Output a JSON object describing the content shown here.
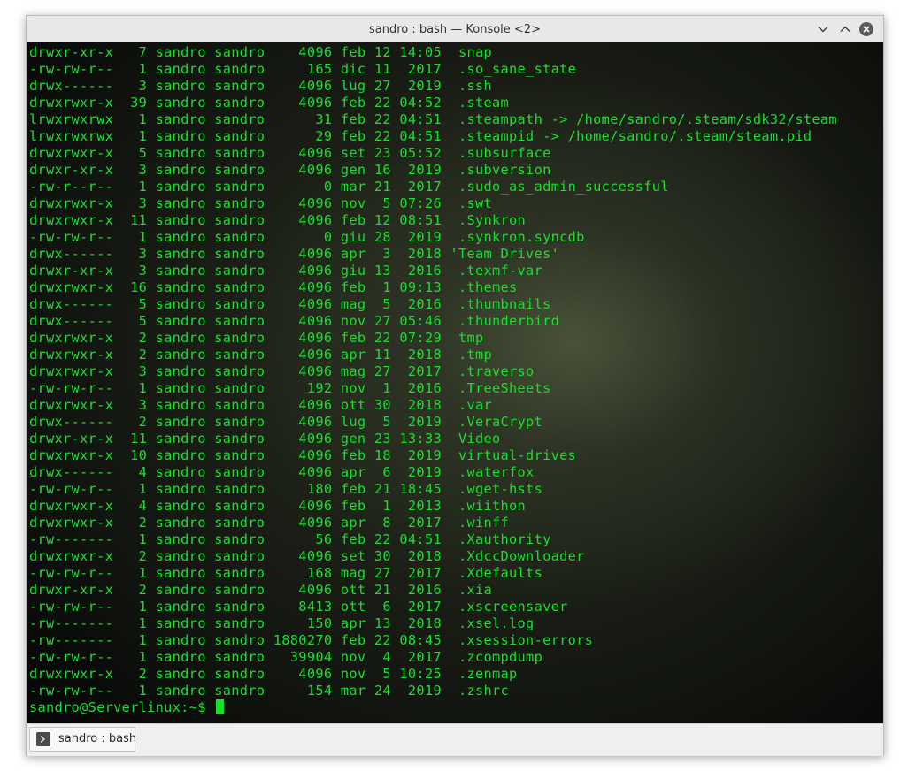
{
  "window": {
    "title": "sandro : bash — Konsole <2>"
  },
  "terminal": {
    "lines": [
      "drwxr-xr-x   7 sandro sandro    4096 feb 12 14:05  snap",
      "-rw-rw-r--   1 sandro sandro     165 dic 11  2017  .so_sane_state",
      "drwx------   3 sandro sandro    4096 lug 27  2019  .ssh",
      "drwxrwxr-x  39 sandro sandro    4096 feb 22 04:52  .steam",
      "lrwxrwxrwx   1 sandro sandro      31 feb 22 04:51  .steampath -> /home/sandro/.steam/sdk32/steam",
      "lrwxrwxrwx   1 sandro sandro      29 feb 22 04:51  .steampid -> /home/sandro/.steam/steam.pid",
      "drwxrwxr-x   5 sandro sandro    4096 set 23 05:52  .subsurface",
      "drwxr-xr-x   3 sandro sandro    4096 gen 16  2019  .subversion",
      "-rw-r--r--   1 sandro sandro       0 mar 21  2017  .sudo_as_admin_successful",
      "drwxrwxr-x   3 sandro sandro    4096 nov  5 07:26  .swt",
      "drwxrwxr-x  11 sandro sandro    4096 feb 12 08:51  .Synkron",
      "-rw-rw-r--   1 sandro sandro       0 giu 28  2019  .synkron.syncdb",
      "drwx------   3 sandro sandro    4096 apr  3  2018 'Team Drives'",
      "drwxr-xr-x   3 sandro sandro    4096 giu 13  2016  .texmf-var",
      "drwxrwxr-x  16 sandro sandro    4096 feb  1 09:13  .themes",
      "drwx------   5 sandro sandro    4096 mag  5  2016  .thumbnails",
      "drwx------   5 sandro sandro    4096 nov 27 05:46  .thunderbird",
      "drwxrwxr-x   2 sandro sandro    4096 feb 22 07:29  tmp",
      "drwxrwxr-x   2 sandro sandro    4096 apr 11  2018  .tmp",
      "drwxrwxr-x   3 sandro sandro    4096 mag 27  2017  .traverso",
      "-rw-rw-r--   1 sandro sandro     192 nov  1  2016  .TreeSheets",
      "drwxrwxr-x   3 sandro sandro    4096 ott 30  2018  .var",
      "drwx------   2 sandro sandro    4096 lug  5  2019  .VeraCrypt",
      "drwxr-xr-x  11 sandro sandro    4096 gen 23 13:33  Video",
      "drwxrwxr-x  10 sandro sandro    4096 feb 18  2019  virtual-drives",
      "drwx------   4 sandro sandro    4096 apr  6  2019  .waterfox",
      "-rw-rw-r--   1 sandro sandro     180 feb 21 18:45  .wget-hsts",
      "drwxrwxr-x   4 sandro sandro    4096 feb  1  2013  .wiithon",
      "drwxrwxr-x   2 sandro sandro    4096 apr  8  2017  .winff",
      "-rw-------   1 sandro sandro      56 feb 22 04:51  .Xauthority",
      "drwxrwxr-x   2 sandro sandro    4096 set 30  2018  .XdccDownloader",
      "-rw-rw-r--   1 sandro sandro     168 mag 27  2017  .Xdefaults",
      "drwxr-xr-x   2 sandro sandro    4096 ott 21  2016  .xia",
      "-rw-rw-r--   1 sandro sandro    8413 ott  6  2017  .xscreensaver",
      "-rw-------   1 sandro sandro     150 apr 13  2018  .xsel.log",
      "-rw-------   1 sandro sandro 1880270 feb 22 08:45  .xsession-errors",
      "-rw-rw-r--   1 sandro sandro   39904 nov  4  2017  .zcompdump",
      "drwxrwxr-x   2 sandro sandro    4096 nov  5 10:25  .zenmap",
      "-rw-rw-r--   1 sandro sandro     154 mar 24  2019  .zshrc"
    ],
    "prompt": "sandro@Serverlinux:~$ ",
    "text_color": "#18e02a"
  },
  "tabs": [
    {
      "label": "sandro : bash",
      "icon": "terminal-icon"
    }
  ],
  "icons": {
    "minimize": "chevron-down-icon",
    "maximize": "chevron-up-icon",
    "close": "close-icon"
  }
}
